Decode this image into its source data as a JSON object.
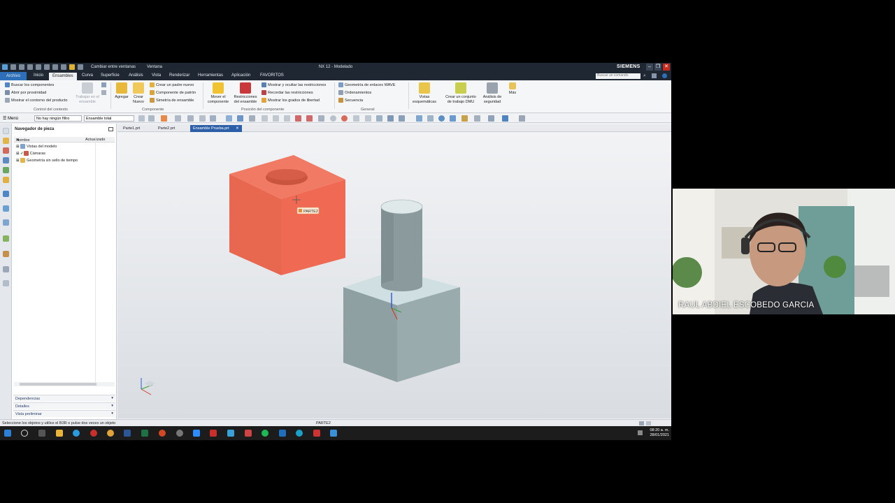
{
  "window": {
    "title": "NX 12 - Modelado",
    "brand": "SIEMENS",
    "quick_access": {
      "switch_windows": "Cambiar entre ventanas",
      "window_menu": "Ventana"
    },
    "controls": [
      "–",
      "❐",
      "✕"
    ]
  },
  "menu_tabs": {
    "file": "Archivo",
    "items": [
      "Inicio",
      "Ensambles",
      "Curva",
      "Superficie",
      "Análisis",
      "Vista",
      "Renderizar",
      "Herramientas",
      "Aplicación",
      "FAVORITOS"
    ],
    "active": "Ensambles",
    "search_placeholder": "Buscar un comando"
  },
  "ribbon": {
    "context_control": {
      "items": [
        "Buscar los componentes",
        "Abrir por proximidad",
        "Mostrar el contorno del producto"
      ],
      "work_in_assembly": "Trabajar en el ensamble",
      "label": "Control del contexto"
    },
    "component": {
      "add": "Agregar",
      "create_new": "Crear Nuevo",
      "items": [
        "Crear un padre nuevo",
        "Componente de patrón",
        "Simetría de ensamble"
      ],
      "label": "Componente"
    },
    "position": {
      "move_l1": "Mover el",
      "move_l2": "componente",
      "constraints_l1": "Restricciones",
      "constraints_l2": "del ensamble",
      "items": [
        "Mostrar y ocultar las restricciones",
        "Recordar las restricciones",
        "Mostrar los grados de libertad"
      ],
      "label": "Posición del componente"
    },
    "general": {
      "items": [
        "Geometría de enlaces WAVE",
        "Ordenamientos",
        "Secuencia"
      ],
      "label": "General"
    },
    "exploded": {
      "l1": "Vistas",
      "l2": "esquemáticas"
    },
    "dmu": {
      "l1": "Crear un conjunto",
      "l2": "de trabajo DMU"
    },
    "safety": {
      "l1": "Análisis de",
      "l2": "seguridad"
    },
    "more": "Más"
  },
  "toolbar": {
    "menu": "Menú",
    "filter": "No hay ningún filtro",
    "scope": "Ensamble total"
  },
  "navigator": {
    "title": "Navegador de pieza",
    "columns": [
      "Nombre",
      "Actualizado"
    ],
    "rows": [
      "Vistas del modelo",
      "Cámaras",
      "Geometría sin sello de tiempo"
    ],
    "panels": [
      "Dependencias",
      "Detalles",
      "Vista preliminar"
    ]
  },
  "doc_tabs": [
    "Parte1.prt",
    "Parte2.prt",
    "Ensamble Prueba.prt"
  ],
  "active_doc": "Ensamble Prueba.prt",
  "viewport": {
    "tooltip": "PARTE2",
    "colors": {
      "cube": "#e8674f",
      "base": "#8fa0a3",
      "bg_top": "#f2f3f5",
      "bg_bottom": "#d9dde2"
    }
  },
  "status": {
    "message": "Seleccione los objetos y utilice el B3R o pulse dos veces un objeto",
    "center": "PARTE2"
  },
  "taskbar": {
    "time": "08:20 a. m.",
    "date": "28/01/2021"
  },
  "webcam": {
    "participant_name": "RAUL ABDIEL ESCOBEDO GARCIA"
  }
}
